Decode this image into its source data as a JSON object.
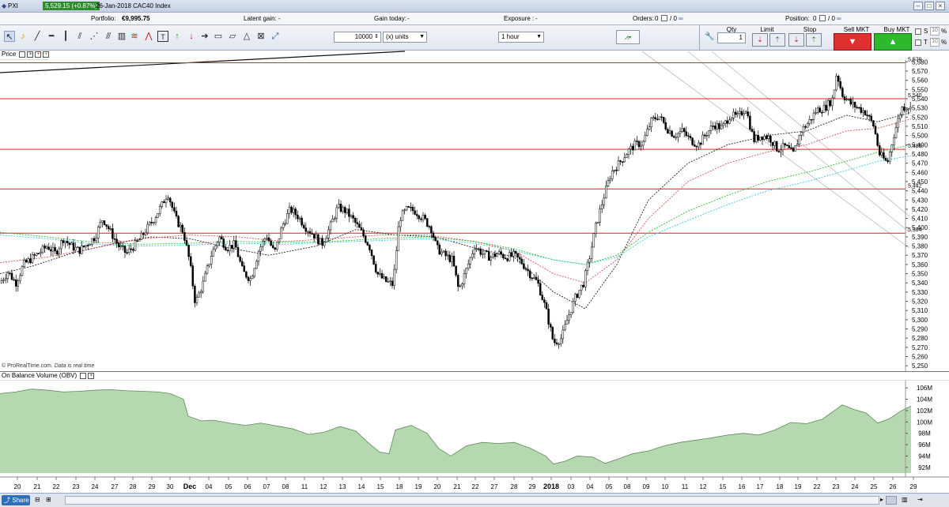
{
  "window": {
    "title": "PXI",
    "quote": "5,529.15 (+0.87%)",
    "instrument": "26-Jan-2018 CAC40 Index"
  },
  "status": {
    "portfolio_label": "Portfolio:",
    "portfolio_value": "€9,995.75",
    "latent_label": "Latent gain:",
    "latent_value": "-",
    "gain_label": "Gain today:",
    "gain_value": "-",
    "exposure_label": "Exposure :",
    "exposure_value": "-",
    "orders_label": "Orders:",
    "orders_value": "0",
    "orders_value2": "/ 0",
    "position_label": "Position:",
    "position_value": "0",
    "position_value2": "/ 0"
  },
  "toolbar": {
    "quantity": "10000",
    "units": "(x) units",
    "timeframe": "1 hour",
    "qty_label": "Qty",
    "qty_value": "1",
    "limit_label": "Limit",
    "stop_label": "Stop",
    "sell_label": "Sell MKT",
    "buy_label": "Buy MKT",
    "s_label": "S",
    "t_label": "T",
    "s_pct": "10",
    "t_pct": "10",
    "pct": "%"
  },
  "panels": {
    "price_label": "Price",
    "obv_label": "On Balance Volume (OBV)"
  },
  "copyright": {
    "text": "© ProRealTime.com.",
    "note": "Data is real time"
  },
  "bottom": {
    "share_label": "Share"
  },
  "colors": {
    "up": "#ffffff",
    "down": "#000000",
    "hline": "#e02020",
    "obv_fill": "#b6d8b0",
    "obv_line": "#5a8a55"
  },
  "chart_data": {
    "type": "candlestick",
    "price_axis_labels": [
      "5,580",
      "5,570",
      "5,560",
      "5,550",
      "5,540",
      "5,530",
      "5,520",
      "5,510",
      "5,500",
      "5,490",
      "5,480",
      "5,470",
      "5,460",
      "5,450",
      "5,440",
      "5,430",
      "5,420",
      "5,410",
      "5,400",
      "5,390",
      "5,380",
      "5,370",
      "5,360",
      "5,350",
      "5,340",
      "5,330",
      "5,320",
      "5,310",
      "5,300",
      "5,290",
      "5,280",
      "5,270",
      "5,260",
      "5,250"
    ],
    "ylim": [
      5245,
      5582
    ],
    "levels": [
      {
        "label": "5,579",
        "value": 5579
      },
      {
        "label": "5,540",
        "value": 5540
      },
      {
        "label": "5,485",
        "value": 5485
      },
      {
        "label": "5,442",
        "value": 5442
      },
      {
        "label": "5,394",
        "value": 5394
      }
    ],
    "obv_axis_labels": [
      "106M",
      "104M",
      "102M",
      "100M",
      "98M",
      "96M",
      "94M",
      "92M"
    ],
    "obv_ylim": [
      91,
      107
    ],
    "x_labels": [
      "20",
      "21",
      "22",
      "23",
      "24",
      "27",
      "28",
      "29",
      "30",
      "Dec",
      "04",
      "05",
      "06",
      "07",
      "08",
      "11",
      "12",
      "13",
      "14",
      "15",
      "18",
      "19",
      "20",
      "21",
      "22",
      "27",
      "28",
      "29",
      "2018",
      "03",
      "04",
      "05",
      "08",
      "09",
      "10",
      "11",
      "12",
      "15",
      "16",
      "17",
      "18",
      "19",
      "22",
      "23",
      "24",
      "25",
      "26",
      "29"
    ],
    "x_label_positions": [
      22,
      47,
      71,
      96,
      120,
      145,
      168,
      192,
      215,
      240,
      264,
      289,
      313,
      337,
      361,
      385,
      409,
      433,
      457,
      481,
      505,
      529,
      553,
      578,
      601,
      625,
      650,
      673,
      697,
      722,
      746,
      770,
      793,
      817,
      841,
      866,
      889,
      914,
      938,
      961,
      986,
      1009,
      1033,
      1057,
      1081,
      1105,
      1129,
      1155
    ],
    "close_path": [
      [
        0,
        5340
      ],
      [
        10,
        5352
      ],
      [
        20,
        5340
      ],
      [
        30,
        5360
      ],
      [
        45,
        5370
      ],
      [
        60,
        5380
      ],
      [
        70,
        5372
      ],
      [
        80,
        5388
      ],
      [
        90,
        5380
      ],
      [
        100,
        5375
      ],
      [
        110,
        5382
      ],
      [
        120,
        5390
      ],
      [
        130,
        5410
      ],
      [
        140,
        5395
      ],
      [
        150,
        5380
      ],
      [
        160,
        5372
      ],
      [
        175,
        5385
      ],
      [
        185,
        5398
      ],
      [
        195,
        5410
      ],
      [
        205,
        5425
      ],
      [
        212,
        5438
      ],
      [
        222,
        5410
      ],
      [
        232,
        5395
      ],
      [
        240,
        5362
      ],
      [
        247,
        5318
      ],
      [
        257,
        5340
      ],
      [
        267,
        5370
      ],
      [
        277,
        5390
      ],
      [
        287,
        5378
      ],
      [
        297,
        5382
      ],
      [
        307,
        5352
      ],
      [
        317,
        5344
      ],
      [
        327,
        5375
      ],
      [
        337,
        5392
      ],
      [
        347,
        5372
      ],
      [
        357,
        5402
      ],
      [
        367,
        5420
      ],
      [
        377,
        5412
      ],
      [
        387,
        5400
      ],
      [
        397,
        5392
      ],
      [
        407,
        5382
      ],
      [
        417,
        5400
      ],
      [
        427,
        5422
      ],
      [
        437,
        5418
      ],
      [
        447,
        5408
      ],
      [
        457,
        5395
      ],
      [
        467,
        5380
      ],
      [
        477,
        5350
      ],
      [
        487,
        5342
      ],
      [
        497,
        5338
      ],
      [
        505,
        5410
      ],
      [
        515,
        5420
      ],
      [
        525,
        5418
      ],
      [
        535,
        5410
      ],
      [
        545,
        5400
      ],
      [
        552,
        5378
      ],
      [
        562,
        5370
      ],
      [
        572,
        5365
      ],
      [
        580,
        5332
      ],
      [
        590,
        5355
      ],
      [
        600,
        5380
      ],
      [
        610,
        5372
      ],
      [
        620,
        5368
      ],
      [
        630,
        5372
      ],
      [
        640,
        5368
      ],
      [
        650,
        5370
      ],
      [
        660,
        5362
      ],
      [
        670,
        5350
      ],
      [
        680,
        5340
      ],
      [
        690,
        5312
      ],
      [
        700,
        5275
      ],
      [
        710,
        5280
      ],
      [
        718,
        5302
      ],
      [
        728,
        5325
      ],
      [
        738,
        5340
      ],
      [
        746,
        5370
      ],
      [
        753,
        5400
      ],
      [
        763,
        5432
      ],
      [
        773,
        5460
      ],
      [
        783,
        5470
      ],
      [
        793,
        5482
      ],
      [
        803,
        5490
      ],
      [
        813,
        5492
      ],
      [
        823,
        5515
      ],
      [
        833,
        5522
      ],
      [
        843,
        5508
      ],
      [
        853,
        5500
      ],
      [
        863,
        5505
      ],
      [
        873,
        5495
      ],
      [
        883,
        5490
      ],
      [
        893,
        5502
      ],
      [
        903,
        5512
      ],
      [
        913,
        5508
      ],
      [
        923,
        5522
      ],
      [
        933,
        5520
      ],
      [
        943,
        5530
      ],
      [
        953,
        5495
      ],
      [
        963,
        5500
      ],
      [
        973,
        5498
      ],
      [
        983,
        5485
      ],
      [
        993,
        5488
      ],
      [
        1003,
        5480
      ],
      [
        1013,
        5505
      ],
      [
        1023,
        5515
      ],
      [
        1033,
        5528
      ],
      [
        1043,
        5530
      ],
      [
        1053,
        5540
      ],
      [
        1058,
        5568
      ],
      [
        1065,
        5545
      ],
      [
        1075,
        5535
      ],
      [
        1085,
        5530
      ],
      [
        1095,
        5525
      ],
      [
        1105,
        5510
      ],
      [
        1112,
        5480
      ],
      [
        1122,
        5470
      ],
      [
        1130,
        5500
      ],
      [
        1140,
        5530
      ],
      [
        1148,
        5532
      ],
      [
        1152,
        5528
      ]
    ],
    "obv_path": [
      [
        0,
        105.0
      ],
      [
        20,
        105.3
      ],
      [
        40,
        105.8
      ],
      [
        60,
        105.6
      ],
      [
        80,
        105.3
      ],
      [
        100,
        105.4
      ],
      [
        120,
        105.6
      ],
      [
        140,
        105.7
      ],
      [
        160,
        105.5
      ],
      [
        180,
        105.4
      ],
      [
        200,
        105.3
      ],
      [
        215,
        105.0
      ],
      [
        232,
        104.0
      ],
      [
        238,
        101.0
      ],
      [
        255,
        100.2
      ],
      [
        270,
        100.3
      ],
      [
        290,
        99.8
      ],
      [
        310,
        99.4
      ],
      [
        330,
        99.8
      ],
      [
        350,
        99.3
      ],
      [
        370,
        98.8
      ],
      [
        390,
        97.8
      ],
      [
        410,
        98.2
      ],
      [
        430,
        99.2
      ],
      [
        450,
        98.4
      ],
      [
        465,
        96.4
      ],
      [
        480,
        94.7
      ],
      [
        492,
        94.4
      ],
      [
        500,
        98.6
      ],
      [
        520,
        99.4
      ],
      [
        540,
        98.0
      ],
      [
        555,
        95.3
      ],
      [
        570,
        94.0
      ],
      [
        590,
        95.8
      ],
      [
        610,
        96.4
      ],
      [
        630,
        96.2
      ],
      [
        650,
        96.4
      ],
      [
        670,
        95.4
      ],
      [
        690,
        94.0
      ],
      [
        700,
        92.6
      ],
      [
        715,
        93.1
      ],
      [
        730,
        94.0
      ],
      [
        750,
        93.8
      ],
      [
        765,
        92.7
      ],
      [
        780,
        93.4
      ],
      [
        800,
        94.4
      ],
      [
        820,
        94.9
      ],
      [
        840,
        95.8
      ],
      [
        860,
        96.4
      ],
      [
        880,
        96.8
      ],
      [
        900,
        97.2
      ],
      [
        920,
        97.7
      ],
      [
        940,
        98.0
      ],
      [
        960,
        97.7
      ],
      [
        980,
        98.6
      ],
      [
        1000,
        99.9
      ],
      [
        1020,
        99.7
      ],
      [
        1040,
        100.5
      ],
      [
        1055,
        102.0
      ],
      [
        1065,
        103.0
      ],
      [
        1080,
        102.2
      ],
      [
        1095,
        101.6
      ],
      [
        1110,
        99.8
      ],
      [
        1125,
        100.6
      ],
      [
        1140,
        102.0
      ],
      [
        1152,
        102.8
      ]
    ],
    "ma_fast_path": [
      [
        0,
        5350
      ],
      [
        40,
        5358
      ],
      [
        90,
        5372
      ],
      [
        140,
        5382
      ],
      [
        190,
        5390
      ],
      [
        240,
        5388
      ],
      [
        290,
        5378
      ],
      [
        340,
        5370
      ],
      [
        400,
        5380
      ],
      [
        450,
        5398
      ],
      [
        500,
        5392
      ],
      [
        550,
        5390
      ],
      [
        600,
        5378
      ],
      [
        650,
        5368
      ],
      [
        700,
        5330
      ],
      [
        740,
        5312
      ],
      [
        780,
        5360
      ],
      [
        820,
        5430
      ],
      [
        870,
        5470
      ],
      [
        920,
        5490
      ],
      [
        970,
        5500
      ],
      [
        1020,
        5505
      ],
      [
        1070,
        5522
      ],
      [
        1110,
        5515
      ],
      [
        1152,
        5525
      ]
    ],
    "ma_med_path": [
      [
        0,
        5362
      ],
      [
        60,
        5368
      ],
      [
        120,
        5378
      ],
      [
        180,
        5388
      ],
      [
        240,
        5392
      ],
      [
        300,
        5390
      ],
      [
        360,
        5385
      ],
      [
        420,
        5388
      ],
      [
        480,
        5392
      ],
      [
        540,
        5392
      ],
      [
        600,
        5385
      ],
      [
        650,
        5375
      ],
      [
        700,
        5350
      ],
      [
        740,
        5340
      ],
      [
        780,
        5365
      ],
      [
        820,
        5410
      ],
      [
        870,
        5450
      ],
      [
        920,
        5470
      ],
      [
        970,
        5482
      ],
      [
        1020,
        5490
      ],
      [
        1070,
        5505
      ],
      [
        1110,
        5508
      ],
      [
        1152,
        5518
      ]
    ],
    "ma_slow_path": [
      [
        0,
        5395
      ],
      [
        60,
        5390
      ],
      [
        120,
        5384
      ],
      [
        180,
        5382
      ],
      [
        240,
        5383
      ],
      [
        300,
        5385
      ],
      [
        360,
        5384
      ],
      [
        420,
        5385
      ],
      [
        480,
        5388
      ],
      [
        540,
        5390
      ],
      [
        600,
        5385
      ],
      [
        650,
        5377
      ],
      [
        700,
        5365
      ],
      [
        740,
        5360
      ],
      [
        780,
        5370
      ],
      [
        820,
        5395
      ],
      [
        870,
        5418
      ],
      [
        920,
        5435
      ],
      [
        970,
        5450
      ],
      [
        1020,
        5460
      ],
      [
        1070,
        5472
      ],
      [
        1110,
        5482
      ],
      [
        1152,
        5490
      ]
    ],
    "ma_cyan_path": [
      [
        0,
        5392
      ],
      [
        60,
        5388
      ],
      [
        120,
        5382
      ],
      [
        180,
        5380
      ],
      [
        240,
        5381
      ],
      [
        300,
        5383
      ],
      [
        360,
        5382
      ],
      [
        420,
        5384
      ],
      [
        480,
        5386
      ],
      [
        540,
        5388
      ],
      [
        600,
        5383
      ],
      [
        650,
        5375
      ],
      [
        700,
        5365
      ],
      [
        740,
        5360
      ],
      [
        780,
        5368
      ],
      [
        820,
        5390
      ],
      [
        870,
        5408
      ],
      [
        920,
        5425
      ],
      [
        970,
        5440
      ],
      [
        1020,
        5450
      ],
      [
        1070,
        5462
      ],
      [
        1110,
        5472
      ],
      [
        1152,
        5478
      ]
    ]
  }
}
